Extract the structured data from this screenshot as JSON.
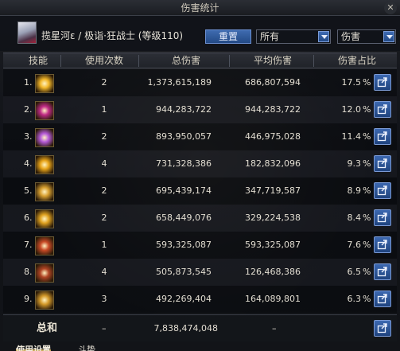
{
  "window": {
    "title": "伤害统计"
  },
  "header": {
    "character": "揽星河ε / 极诣·狂战士 (等级110)",
    "reset_label": "重置",
    "filter_value": "所有",
    "type_value": "伤害"
  },
  "columns": [
    "技能",
    "使用次数",
    "总伤害",
    "平均伤害",
    "伤害占比"
  ],
  "rows": [
    {
      "idx": "1.",
      "count": "2",
      "total": "1,373,615,189",
      "avg": "686,807,594",
      "pct": "17.5",
      "icon_color": "#f2b628"
    },
    {
      "idx": "2.",
      "count": "1",
      "total": "944,283,722",
      "avg": "944,283,722",
      "pct": "12.0",
      "icon_color": "#c02a86"
    },
    {
      "idx": "3.",
      "count": "2",
      "total": "893,950,057",
      "avg": "446,975,028",
      "pct": "11.4",
      "icon_color": "#b55ad8"
    },
    {
      "idx": "4.",
      "count": "4",
      "total": "731,328,386",
      "avg": "182,832,096",
      "pct": "9.3",
      "icon_color": "#e8a418"
    },
    {
      "idx": "5.",
      "count": "2",
      "total": "695,439,174",
      "avg": "347,719,587",
      "pct": "8.9",
      "icon_color": "#d8a030"
    },
    {
      "idx": "6.",
      "count": "2",
      "total": "658,449,076",
      "avg": "329,224,538",
      "pct": "8.4",
      "icon_color": "#e0a220"
    },
    {
      "idx": "7.",
      "count": "1",
      "total": "593,325,087",
      "avg": "593,325,087",
      "pct": "7.6",
      "icon_color": "#c84a26"
    },
    {
      "idx": "8.",
      "count": "4",
      "total": "505,873,545",
      "avg": "126,468,386",
      "pct": "6.5",
      "icon_color": "#b04424"
    },
    {
      "idx": "9.",
      "count": "3",
      "total": "492,269,404",
      "avg": "164,089,801",
      "pct": "6.3",
      "icon_color": "#d49a2a"
    }
  ],
  "pct_sign": "%",
  "total": {
    "label": "总和",
    "count": "–",
    "value": "7,838,474,048",
    "avg": "–"
  },
  "bottom_tabs": [
    "使用设置",
    "斗势"
  ],
  "colors": {
    "accent_button": "#2f5a9c",
    "header_bg": "#24272d"
  }
}
